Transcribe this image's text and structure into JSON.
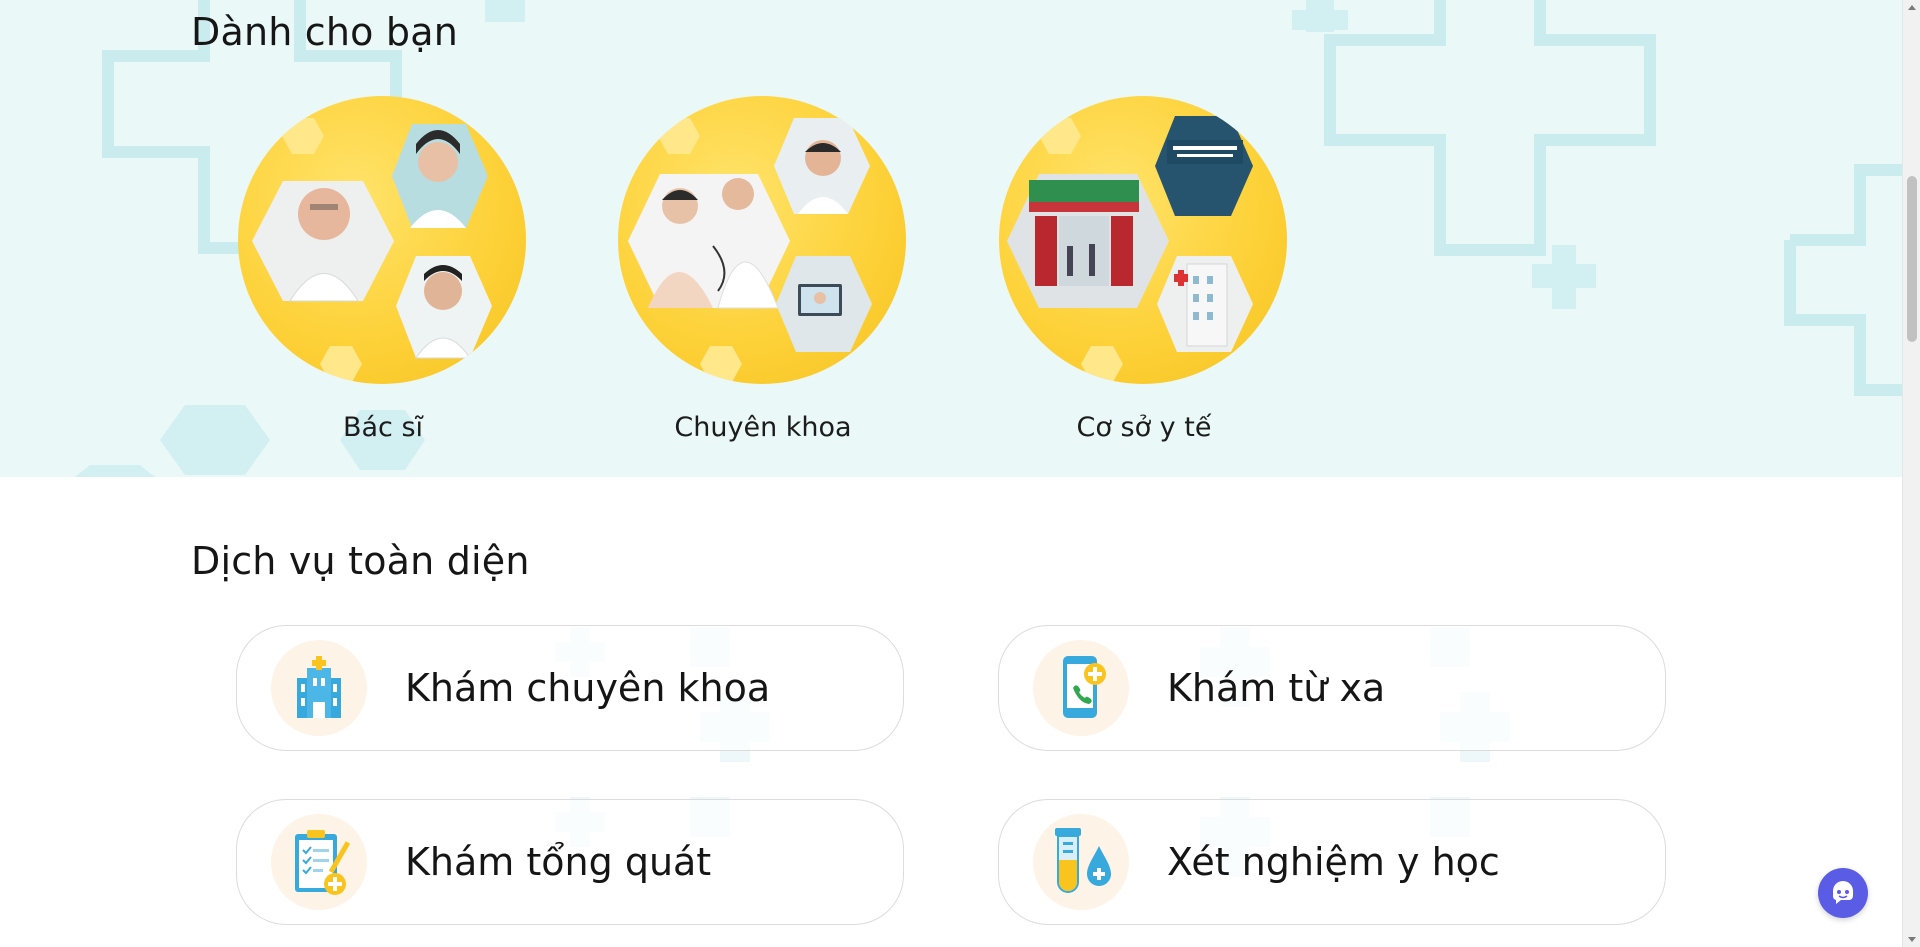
{
  "for_you": {
    "title": "Dành cho bạn",
    "cards": [
      {
        "label": "Bác sĩ",
        "icon": "doctors-photo-collage"
      },
      {
        "label": "Chuyên khoa",
        "icon": "specialty-photo-collage"
      },
      {
        "label": "Cơ sở y tế",
        "icon": "medical-facility-photo-collage"
      }
    ]
  },
  "services": {
    "title": "Dịch vụ toàn diện",
    "items": [
      {
        "label": "Khám chuyên khoa",
        "icon": "hospital-building-icon"
      },
      {
        "label": "Khám từ xa",
        "icon": "phone-telehealth-icon"
      },
      {
        "label": "Khám tổng quát",
        "icon": "clipboard-checklist-icon"
      },
      {
        "label": "Xét nghiệm y học",
        "icon": "test-tube-drop-icon"
      }
    ]
  },
  "colors": {
    "section_bg": "#eaf8f8",
    "card_yellow": "#fdd23a",
    "icon_blue": "#37a9dc",
    "accent_yellow": "#f9c41d",
    "chat_button": "#5a5ce6"
  },
  "chat": {
    "icon": "chat-bot-icon"
  }
}
